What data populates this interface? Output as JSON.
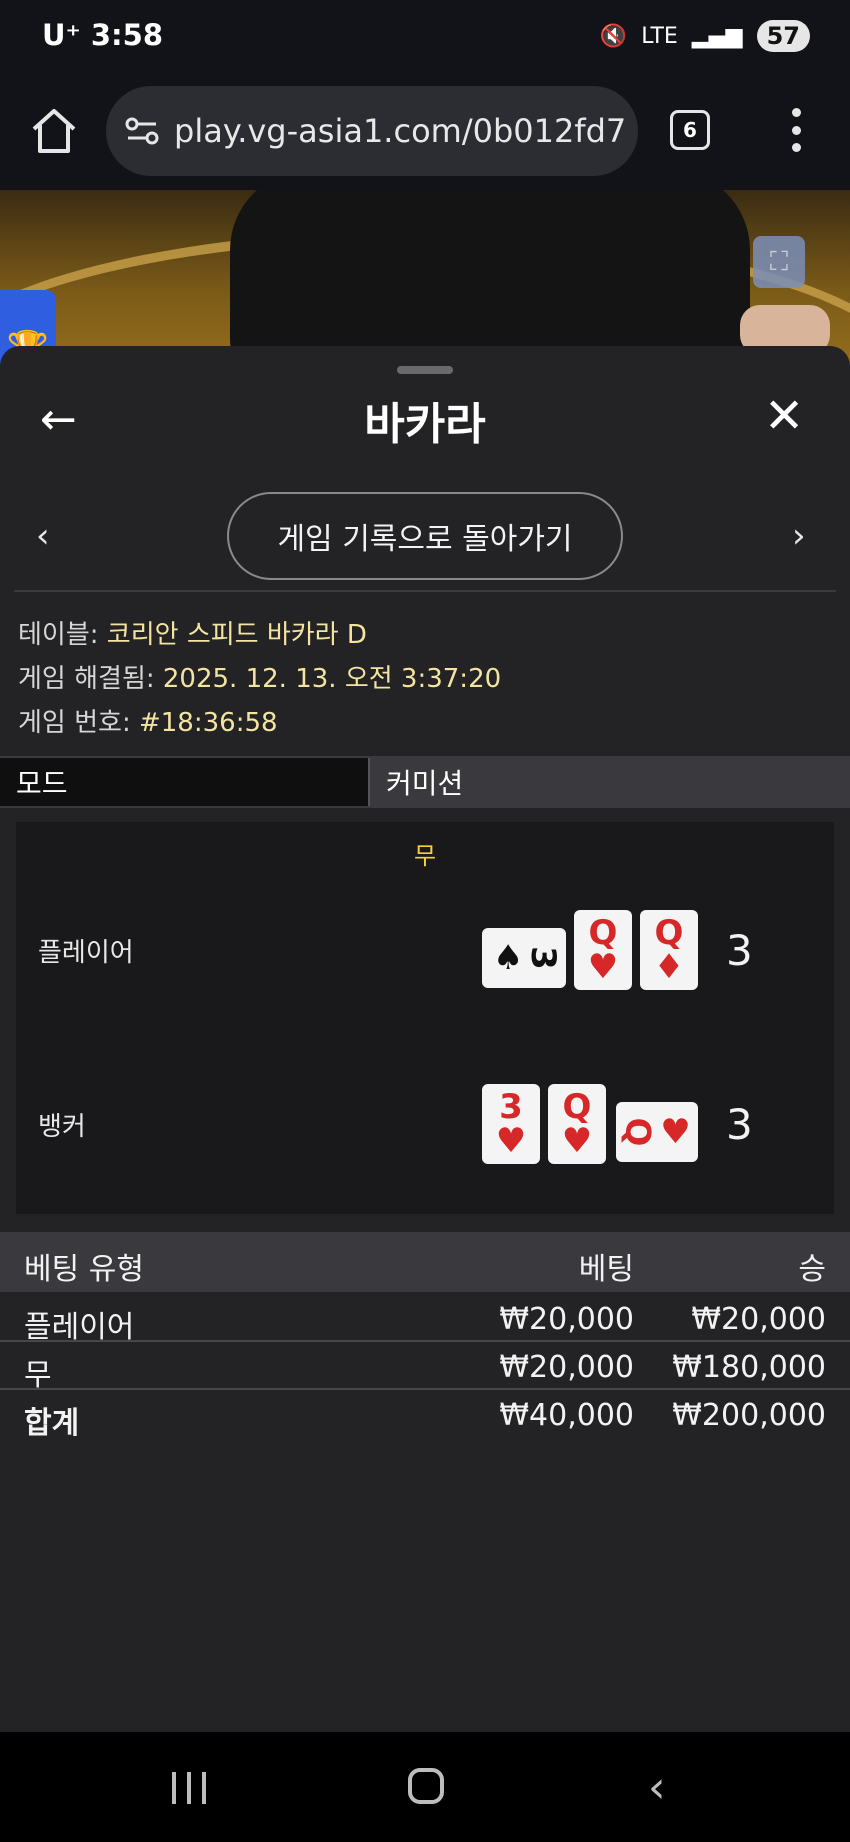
{
  "status": {
    "carrier": "U⁺",
    "time": "3:58",
    "network": "LTE",
    "battery": "57"
  },
  "browser": {
    "url": "play.vg-asia1.com/0b012fd7",
    "tab_count": "6"
  },
  "panel": {
    "title": "바카라",
    "history_button": "게임 기록으로 돌아가기",
    "info": {
      "table_label": "테이블:",
      "table_value": "코리안 스피드 바카라 D",
      "resolved_label": "게임 해결됨:",
      "resolved_value": "2025. 12. 13. 오전 3:37:20",
      "game_no_label": "게임 번호:",
      "game_no_value": "#18:36:58"
    },
    "mode": {
      "label": "모드",
      "value": "커미션"
    },
    "result": {
      "winner": "무",
      "player": {
        "label": "플레이어",
        "score": "3",
        "cards": [
          {
            "rank": "3",
            "suit": "♠"
          },
          {
            "rank": "Q",
            "suit": "♥"
          },
          {
            "rank": "Q",
            "suit": "♦"
          }
        ]
      },
      "banker": {
        "label": "뱅커",
        "score": "3",
        "cards": [
          {
            "rank": "3",
            "suit": "♥"
          },
          {
            "rank": "Q",
            "suit": "♥"
          },
          {
            "rank": "Q",
            "suit": "♥"
          }
        ]
      }
    },
    "bets": {
      "headers": {
        "type": "베팅 유형",
        "bet": "베팅",
        "win": "승"
      },
      "rows": [
        {
          "type": "플레이어",
          "bet": "₩20,000",
          "win": "₩20,000"
        },
        {
          "type": "무",
          "bet": "₩20,000",
          "win": "₩180,000"
        },
        {
          "type": "합계",
          "bet": "₩40,000",
          "win": "₩200,000"
        }
      ]
    }
  }
}
